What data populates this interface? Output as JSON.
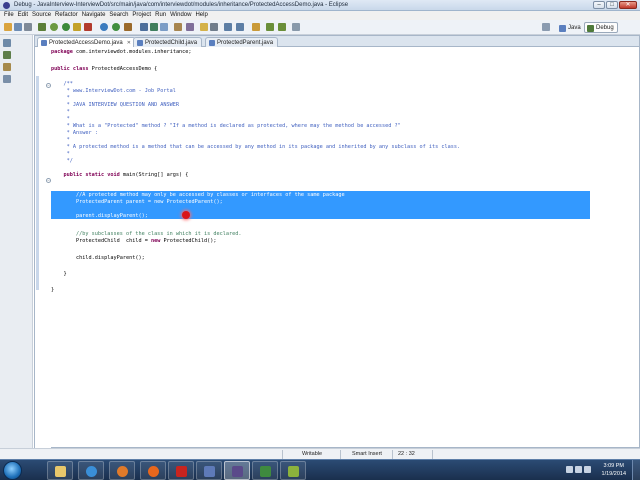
{
  "window": {
    "title": "Debug - JavaInterview-InterviewDot/src/main/java/com/interviewdot/modules/inheritance/ProtectedAccessDemo.java - Eclipse",
    "app_icon": "eclipse-icon"
  },
  "menu": [
    "File",
    "Edit",
    "Source",
    "Refactor",
    "Navigate",
    "Search",
    "Project",
    "Run",
    "Window",
    "Help"
  ],
  "toolbar": {
    "perspectives": [
      {
        "label": "Java",
        "icon": "java-perspective-icon",
        "active": false
      },
      {
        "label": "Debug",
        "icon": "debug-perspective-icon",
        "active": true
      }
    ]
  },
  "tabs": [
    {
      "label": "ProtectedAccessDemo.java",
      "active": true,
      "close": "✕"
    },
    {
      "label": "ProtectedChild.java",
      "active": false
    },
    {
      "label": "ProtectedParent.java",
      "active": false
    }
  ],
  "code": {
    "lines": [
      "package com.interviewdot.modules.inheritance;",
      "",
      "public class ProtectedAccessDemo {",
      "",
      "    /**",
      "     * www.InterviewDot.com - Job Portal",
      "     *",
      "     * JAVA INTERVIEW QUESTION AND ANSWER",
      "     *",
      "     *",
      "     * What is a \"Protected\" method ? \"If a method is declared as protected, where may the method be accessed ?\"",
      "     * Answer :",
      "     *",
      "     * A protected method is a method that can be accessed by any method in its package and inherited by any subclass of its class.",
      "     *",
      "     */",
      "    public static void main(String[] args) {",
      "        //A protected method may only be accessed by classes or interfaces of the same package",
      "        ProtectedParent parent = new ProtectedParent();",
      "",
      "        parent.displayParent();",
      "",
      "        //by subclasses of the class in which it is declared.",
      "        ProtectedChild  child = new ProtectedChild();",
      "",
      "        child.displayParent();",
      "",
      "    }",
      "",
      "}"
    ]
  },
  "status": {
    "writable": "Writable",
    "insert_mode": "Smart Insert",
    "position": "22 : 32"
  },
  "taskbar": {
    "apps": [
      "windows-explorer-icon",
      "internet-explorer-icon",
      "media-player-icon",
      "firefox-icon",
      "acrobat-icon",
      "save-icon",
      "eclipse-taskbar-icon",
      "spreadsheet-icon",
      "editor-icon"
    ],
    "time": "3:09 PM",
    "date": "1/19/2014"
  }
}
